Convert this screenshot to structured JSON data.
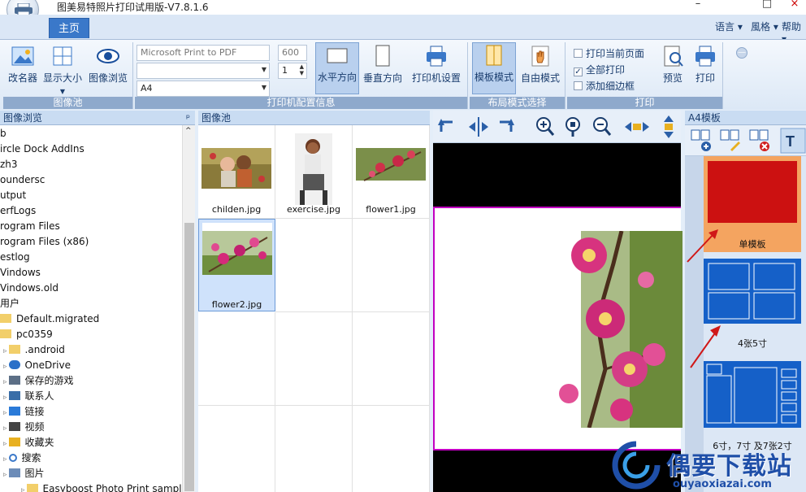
{
  "window": {
    "title": "图美易特照片打印试用版-V7.8.1.6",
    "minimize": "–",
    "maximize": "□",
    "close": "×"
  },
  "ribbon": {
    "tab": "主页",
    "menus": [
      "语言",
      "風格",
      "帮助"
    ],
    "groups": {
      "image_pool": {
        "label": "图像池",
        "buttons": [
          "改名器",
          "显示大小",
          "图像浏览"
        ]
      },
      "printer": {
        "label": "打印机配置信息",
        "printer_name": "Microsoft Print to PDF",
        "tray": "",
        "paper": "A4",
        "dpi": "600",
        "copies": "1",
        "buttons": [
          "水平方向",
          "垂直方向",
          "打印机设置"
        ]
      },
      "layout": {
        "label": "布局模式选择",
        "buttons": [
          "模板模式",
          "自由模式"
        ]
      },
      "print": {
        "label": "打印",
        "options": [
          "打印当前页面",
          "全部打印",
          "添加细边框"
        ],
        "buttons": [
          "预览",
          "打印"
        ]
      }
    }
  },
  "browser": {
    "header": "图像浏览",
    "pin": "ᵖ",
    "items": [
      "b",
      "ircle Dock AddIns",
      "zh3",
      "oundersc",
      "utput",
      "erfLogs",
      "rogram Files",
      "rogram Files (x86)",
      "estlog",
      "Vindows",
      "Vindows.old",
      "用户",
      "Default.migrated",
      "pc0359",
      ".android",
      "OneDrive",
      "保存的游戏",
      "联系人",
      "链接",
      "视频",
      "收藏夹",
      "搜索",
      "图片",
      "Easyboost Photo Print samples"
    ]
  },
  "pool": {
    "header": "图像池",
    "images": [
      "childen.jpg",
      "exercise.jpg",
      "flower1.jpg",
      "flower2.jpg"
    ]
  },
  "templates": {
    "header": "A4模板",
    "items": [
      "单模板",
      "4张5寸",
      "6寸，7寸 及7张2寸"
    ]
  },
  "watermark": {
    "text": "偶要下载站",
    "sub": "ouyaoxiazai.com"
  },
  "colors": {
    "accent": "#3a78c9",
    "selected_template": "#f4a460",
    "template_red": "#cc1111",
    "template_blue": "#1560c8",
    "frame_border": "#c200c2"
  }
}
